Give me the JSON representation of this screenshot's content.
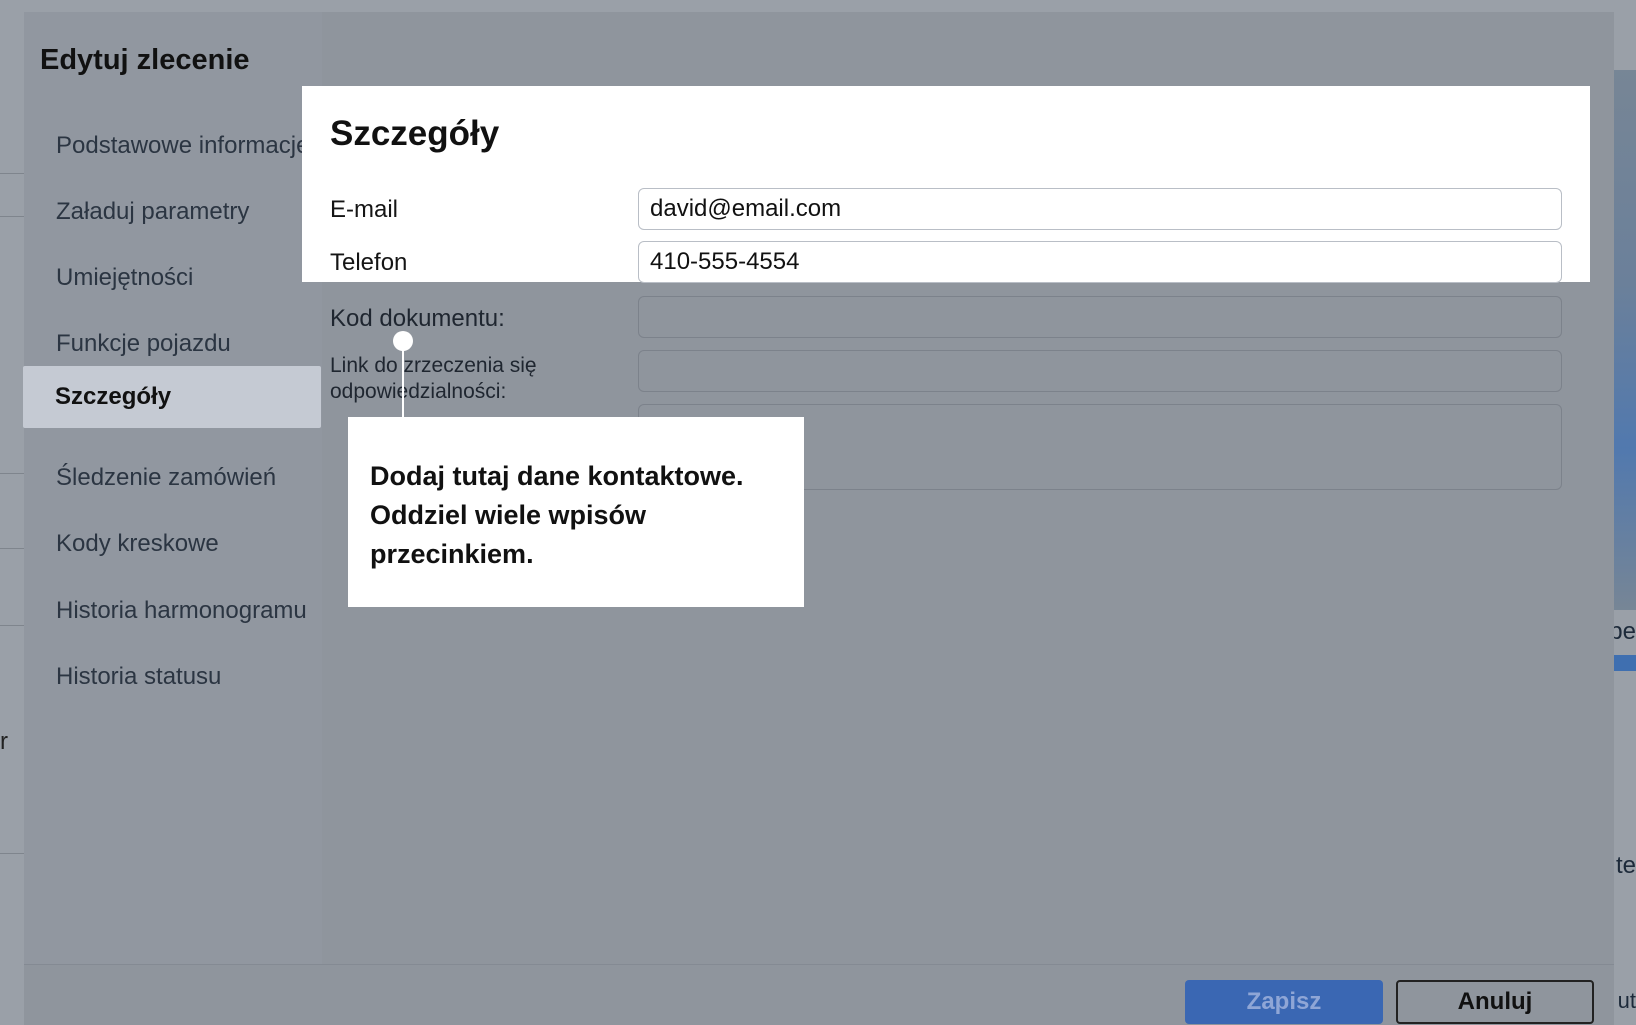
{
  "background": {
    "left_fragment": "r",
    "right_fragments": [
      "pe",
      "te",
      "ut"
    ]
  },
  "modal": {
    "title": "Edytuj zlecenie",
    "nav_items": [
      {
        "label": "Podstawowe informacje",
        "active": false
      },
      {
        "label": "Załaduj parametry",
        "active": false
      },
      {
        "label": "Umiejętności",
        "active": false
      },
      {
        "label": "Funkcje pojazdu",
        "active": false
      },
      {
        "label": "Szczegóły",
        "active": true
      },
      {
        "label": "Śledzenie zamówień",
        "active": false
      },
      {
        "label": "Kody kreskowe",
        "active": false
      },
      {
        "label": "Historia harmonogramu",
        "active": false
      },
      {
        "label": "Historia statusu",
        "active": false
      }
    ]
  },
  "details": {
    "title": "Szczegóły",
    "email_label": "E-mail",
    "email_value": "david@email.com",
    "phone_label": "Telefon",
    "phone_value": "410-555-4554",
    "doc_code_label": "Kod dokumentu:",
    "doc_code_value": "",
    "disclaimer_label_line1": "Link do zrzeczenia się",
    "disclaimer_label_line2": "odpowiedzialności:",
    "disclaimer_value": "",
    "notes_value": ""
  },
  "tooltip": {
    "text_line1": "Dodaj tutaj dane kontaktowe.",
    "text_line2": "Oddziel wiele wpisów",
    "text_line3": "przecinkiem."
  },
  "footer": {
    "save_label": "Zapisz",
    "cancel_label": "Anuluj"
  },
  "colors": {
    "primary": "#3a67b3",
    "overlay": "#8f959d",
    "highlight": "#ffffff"
  }
}
